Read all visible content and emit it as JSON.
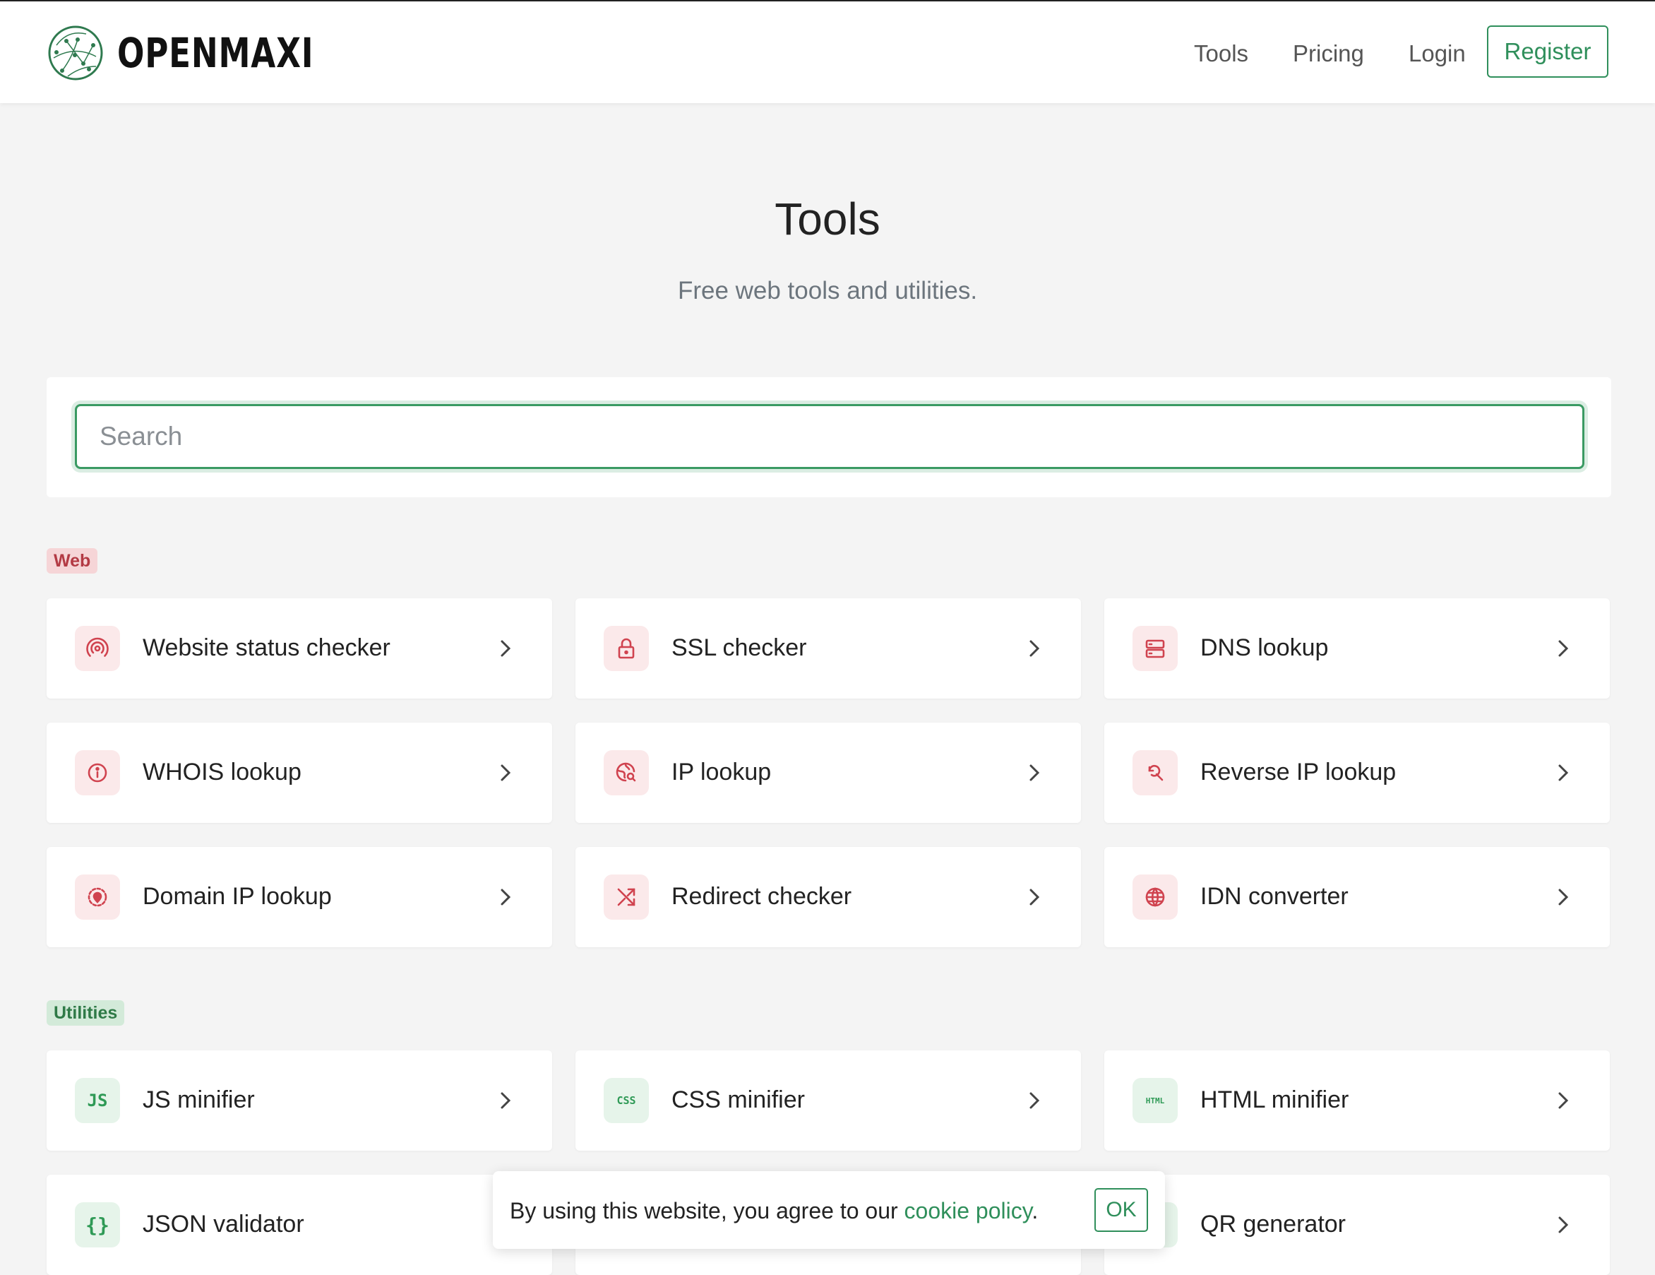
{
  "header": {
    "brand": "OPENMAXI",
    "nav": {
      "tools": "Tools",
      "pricing": "Pricing",
      "login": "Login",
      "register": "Register"
    }
  },
  "hero": {
    "title": "Tools",
    "subtitle": "Free web tools and utilities."
  },
  "search": {
    "placeholder": "Search",
    "value": ""
  },
  "sections": {
    "web": {
      "label": "Web",
      "items": [
        {
          "label": "Website status checker",
          "icon": "broadcast-icon"
        },
        {
          "label": "SSL checker",
          "icon": "lock-icon"
        },
        {
          "label": "DNS lookup",
          "icon": "server-icon"
        },
        {
          "label": "WHOIS lookup",
          "icon": "info-icon"
        },
        {
          "label": "IP lookup",
          "icon": "globe-search-icon"
        },
        {
          "label": "Reverse IP lookup",
          "icon": "search-rotate-icon"
        },
        {
          "label": "Domain IP lookup",
          "icon": "location-pin-icon"
        },
        {
          "label": "Redirect checker",
          "icon": "shuffle-icon"
        },
        {
          "label": "IDN converter",
          "icon": "globe-icon"
        }
      ]
    },
    "utilities": {
      "label": "Utilities",
      "items": [
        {
          "label": "JS minifier",
          "icon": "js-icon",
          "icon_text": "JS"
        },
        {
          "label": "CSS minifier",
          "icon": "css-icon",
          "icon_text": "CSS"
        },
        {
          "label": "HTML minifier",
          "icon": "html-icon",
          "icon_text": "HTML"
        },
        {
          "label": "JSON validator",
          "icon": "braces-icon",
          "icon_text": "{}"
        },
        {
          "label": "QR generator",
          "icon": "qr-icon"
        }
      ]
    }
  },
  "cookie": {
    "text_before": "By using this website, you agree to our ",
    "link": "cookie policy",
    "text_after": ".",
    "ok": "OK"
  },
  "colors": {
    "accent": "#2f8f5b",
    "web": "#d0434f",
    "utilities": "#2f9a56",
    "background": "#f4f4f4"
  }
}
